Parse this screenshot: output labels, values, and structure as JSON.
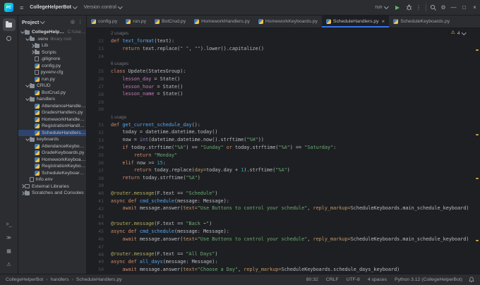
{
  "colors": {
    "bg": "#1e1f22",
    "panel": "#2b2d30",
    "border": "#1a1b1e",
    "text": "#bcbec4",
    "dim": "#9da0a8",
    "gutter": "#4e5157",
    "accent": "#3574f0",
    "selection": "#2e436e",
    "kw": "#cf8e6d",
    "fn": "#56a8f5",
    "str": "#6aab73",
    "num": "#2aacb8",
    "dec": "#b3ae60",
    "field": "#c77dbb",
    "builtin": "#8888c6",
    "kwarg": "#c29a66",
    "annc": "#6f737a",
    "warn": "#f2c55c",
    "green": "#5fb865"
  },
  "title_bar": {
    "logo": "PC",
    "project": "CollegeHelperBot",
    "vcs": "Version control",
    "run_config": "run"
  },
  "activity_bar": {
    "top": [
      {
        "name": "project",
        "active": true
      },
      {
        "name": "commit"
      }
    ],
    "bottom": [
      {
        "name": "terminal"
      },
      {
        "name": "python-console"
      },
      {
        "name": "services"
      },
      {
        "name": "problems"
      }
    ]
  },
  "project_panel": {
    "title": "Project",
    "tree": [
      {
        "level": 0,
        "chevron": "open",
        "icon": "folder",
        "label": "CollegeHelperBot",
        "annotation": "C:\\Users\\...",
        "bold": true
      },
      {
        "level": 1,
        "chevron": "open",
        "icon": "folder",
        "label": ".venv",
        "annotation": "library root"
      },
      {
        "level": 2,
        "chevron": "closed",
        "icon": "folder",
        "label": "Lib"
      },
      {
        "level": 2,
        "chevron": "closed",
        "icon": "folder",
        "label": "Scripts"
      },
      {
        "level": 2,
        "chevron": "none",
        "icon": "file",
        "label": ".gitignore"
      },
      {
        "level": 2,
        "chevron": "none",
        "icon": "py",
        "label": "config.py"
      },
      {
        "level": 2,
        "chevron": "none",
        "icon": "file",
        "label": "pyvenv.cfg"
      },
      {
        "level": 2,
        "chevron": "none",
        "icon": "py",
        "label": "run.py"
      },
      {
        "level": 1,
        "chevron": "open",
        "icon": "folder",
        "label": "CRUD"
      },
      {
        "level": 2,
        "chevron": "none",
        "icon": "py",
        "label": "BotCrud.py"
      },
      {
        "level": 1,
        "chevron": "open",
        "icon": "folder",
        "label": "handlers"
      },
      {
        "level": 2,
        "chevron": "none",
        "icon": "py",
        "label": "AttendanceHandlers.py"
      },
      {
        "level": 2,
        "chevron": "none",
        "icon": "py",
        "label": "GradesHandlers.py"
      },
      {
        "level": 2,
        "chevron": "none",
        "icon": "py",
        "label": "HomeworkHandlers.py"
      },
      {
        "level": 2,
        "chevron": "none",
        "icon": "py",
        "label": "RegistrationHandlers.py"
      },
      {
        "level": 2,
        "chevron": "none",
        "icon": "py",
        "label": "ScheduleHandlers.py",
        "selected": true
      },
      {
        "level": 1,
        "chevron": "open",
        "icon": "folder",
        "label": "keyboards"
      },
      {
        "level": 2,
        "chevron": "none",
        "icon": "py",
        "label": "AttendanceKeyboards.py"
      },
      {
        "level": 2,
        "chevron": "none",
        "icon": "py",
        "label": "GradeKeyboards.py"
      },
      {
        "level": 2,
        "chevron": "none",
        "icon": "py",
        "label": "HomeworkKeyboards.py"
      },
      {
        "level": 2,
        "chevron": "none",
        "icon": "py",
        "label": "RegistrationKeyboards.py"
      },
      {
        "level": 2,
        "chevron": "none",
        "icon": "py",
        "label": "ScheduleKeyboards.py"
      },
      {
        "level": 1,
        "chevron": "none",
        "icon": "file",
        "label": "Info.env"
      },
      {
        "level": 0,
        "chevron": "closed",
        "icon": "lib",
        "label": "External Libraries"
      },
      {
        "level": 0,
        "chevron": "closed",
        "icon": "folder",
        "label": "Scratches and Consoles"
      }
    ]
  },
  "tabs": [
    {
      "label": "config.py"
    },
    {
      "label": "run.py"
    },
    {
      "label": "BotCrud.py"
    },
    {
      "label": "HomeworkHandlers.py"
    },
    {
      "label": "HomeworkKeyboards.py"
    },
    {
      "label": "ScheduleHandlers.py",
      "active": true
    },
    {
      "label": "ScheduleKeyboards.py"
    }
  ],
  "editor": {
    "inspections": {
      "warnings": "4"
    },
    "lines": [
      {
        "ann": "2 usages"
      },
      {
        "n": "22",
        "seg": [
          [
            "k",
            "def "
          ],
          [
            "f",
            "text_format"
          ],
          [
            "d",
            "(text):"
          ]
        ]
      },
      {
        "n": "23",
        "seg": [
          [
            "d",
            "    "
          ],
          [
            "k",
            "return "
          ],
          [
            "d",
            "text.replace("
          ],
          [
            "s",
            "\" \""
          ],
          [
            "d",
            ", "
          ],
          [
            "s",
            "\"\""
          ],
          [
            "d",
            ").lower().capitalize()"
          ]
        ]
      },
      {
        "n": "24",
        "seg": []
      },
      {
        "ann": "6 usages"
      },
      {
        "n": "25",
        "seg": [
          [
            "k",
            "class "
          ],
          [
            "d",
            "Update(StatesGroup):"
          ]
        ]
      },
      {
        "n": "26",
        "seg": [
          [
            "d",
            "    "
          ],
          [
            "fld",
            "lesson_day"
          ],
          [
            "d",
            " = State()"
          ]
        ]
      },
      {
        "n": "27",
        "seg": [
          [
            "d",
            "    "
          ],
          [
            "fld",
            "lesson_hour"
          ],
          [
            "d",
            " = State()"
          ]
        ]
      },
      {
        "n": "28",
        "seg": [
          [
            "d",
            "    "
          ],
          [
            "fld",
            "lesson_name"
          ],
          [
            "d",
            " = State()"
          ]
        ]
      },
      {
        "n": "29",
        "seg": []
      },
      {
        "n": "30",
        "seg": []
      },
      {
        "ann": "1 usage"
      },
      {
        "n": "31",
        "seg": [
          [
            "k",
            "def "
          ],
          [
            "f",
            "get_current_schedule_day"
          ],
          [
            "d",
            "():"
          ]
        ]
      },
      {
        "n": "32",
        "seg": [
          [
            "d",
            "    today = datetime.datetime.today()"
          ]
        ]
      },
      {
        "n": "33",
        "seg": [
          [
            "d",
            "    now = "
          ],
          [
            "b",
            "int"
          ],
          [
            "d",
            "(datetime.datetime.now().strftime("
          ],
          [
            "s",
            "\"%H\""
          ],
          [
            "d",
            "))"
          ]
        ]
      },
      {
        "n": "34",
        "seg": [
          [
            "d",
            "    "
          ],
          [
            "k",
            "if "
          ],
          [
            "d",
            "today.strftime("
          ],
          [
            "s",
            "\"%A\""
          ],
          [
            "d",
            ") == "
          ],
          [
            "s",
            "\"Sunday\""
          ],
          [
            "k",
            " or "
          ],
          [
            "d",
            "today.strftime("
          ],
          [
            "s",
            "\"%A\""
          ],
          [
            "d",
            ") == "
          ],
          [
            "s",
            "\"Saturday\""
          ],
          [
            "d",
            ":"
          ]
        ]
      },
      {
        "n": "35",
        "seg": [
          [
            "d",
            "        "
          ],
          [
            "k",
            "return "
          ],
          [
            "s",
            "\"Monday\""
          ]
        ]
      },
      {
        "n": "36",
        "seg": [
          [
            "d",
            "    "
          ],
          [
            "k",
            "elif "
          ],
          [
            "d",
            "now >= "
          ],
          [
            "n",
            "15"
          ],
          [
            "d",
            ":"
          ]
        ]
      },
      {
        "n": "37",
        "seg": [
          [
            "d",
            "        "
          ],
          [
            "k",
            "return "
          ],
          [
            "d",
            "today.replace("
          ],
          [
            "ka",
            "day="
          ],
          [
            "d",
            "today.day + "
          ],
          [
            "n",
            "1"
          ],
          [
            "d",
            ").strftime("
          ],
          [
            "s",
            "\"%A\""
          ],
          [
            "d",
            ")"
          ]
        ]
      },
      {
        "n": "38",
        "seg": [
          [
            "d",
            "    "
          ],
          [
            "k",
            "return "
          ],
          [
            "d",
            "today.strftime("
          ],
          [
            "s",
            "\"%A\""
          ],
          [
            "d",
            ")"
          ]
        ]
      },
      {
        "n": "39",
        "seg": []
      },
      {
        "n": "40",
        "seg": [
          [
            "dec",
            "@router.message"
          ],
          [
            "d",
            "(F.text == "
          ],
          [
            "s",
            "\"Schedule\""
          ],
          [
            "d",
            ")"
          ]
        ]
      },
      {
        "n": "41",
        "seg": [
          [
            "k",
            "async def "
          ],
          [
            "f",
            "cmd_schedule"
          ],
          [
            "d",
            "(message: Message):"
          ]
        ]
      },
      {
        "n": "42",
        "seg": [
          [
            "d",
            "    "
          ],
          [
            "k",
            "await "
          ],
          [
            "d",
            "message.answer("
          ],
          [
            "ka",
            "text="
          ],
          [
            "s",
            "\"Use Buttons to control your schedule\""
          ],
          [
            "d",
            ", "
          ],
          [
            "ka",
            "reply_markup="
          ],
          [
            "d",
            "ScheduleKeyboards.main_schedule_keyboard)"
          ]
        ]
      },
      {
        "n": "43",
        "seg": []
      },
      {
        "n": "44",
        "seg": [
          [
            "dec",
            "@router.message"
          ],
          [
            "d",
            "(F.text == "
          ],
          [
            "s",
            "\"Back ⬅\""
          ],
          [
            "d",
            ")"
          ]
        ]
      },
      {
        "n": "45",
        "seg": [
          [
            "k",
            "async def "
          ],
          [
            "f",
            "cmd_schedule"
          ],
          [
            "d",
            "(message: Message):"
          ]
        ]
      },
      {
        "n": "46",
        "seg": [
          [
            "d",
            "    "
          ],
          [
            "k",
            "await "
          ],
          [
            "d",
            "message.answer("
          ],
          [
            "ka",
            "text="
          ],
          [
            "s",
            "\"Use Buttons to control your schedule\""
          ],
          [
            "d",
            ", "
          ],
          [
            "ka",
            "reply_markup="
          ],
          [
            "d",
            "ScheduleKeyboards.main_schedule_keyboard)"
          ]
        ]
      },
      {
        "n": "47",
        "seg": []
      },
      {
        "n": "48",
        "seg": [
          [
            "dec",
            "@router.message"
          ],
          [
            "d",
            "(F.text == "
          ],
          [
            "s",
            "\"All Days\""
          ],
          [
            "d",
            ")"
          ]
        ]
      },
      {
        "n": "49",
        "seg": [
          [
            "k",
            "async def "
          ],
          [
            "f",
            "all_days"
          ],
          [
            "d",
            "(message: Message):"
          ]
        ]
      },
      {
        "n": "50",
        "seg": [
          [
            "d",
            "    "
          ],
          [
            "k",
            "await "
          ],
          [
            "d",
            "message.answer("
          ],
          [
            "ka",
            "text="
          ],
          [
            "s",
            "\"Choose a Day\""
          ],
          [
            "d",
            ", "
          ],
          [
            "ka",
            "reply_markup="
          ],
          [
            "d",
            "ScheduleKeyboards.schedule_days_keyboard)"
          ]
        ]
      }
    ]
  },
  "status_bar": {
    "breadcrumbs": [
      "CollegeHelperBot",
      "handlers",
      "ScheduleHandlers.py"
    ],
    "widgets": [
      {
        "name": "caret-position",
        "label": "80:32"
      },
      {
        "name": "line-separator",
        "label": "CRLF"
      },
      {
        "name": "encoding",
        "label": "UTF-8"
      },
      {
        "name": "indent",
        "label": "4 spaces"
      },
      {
        "name": "interpreter",
        "label": "Python 3.12 (CollegeHelperBot)"
      }
    ]
  }
}
